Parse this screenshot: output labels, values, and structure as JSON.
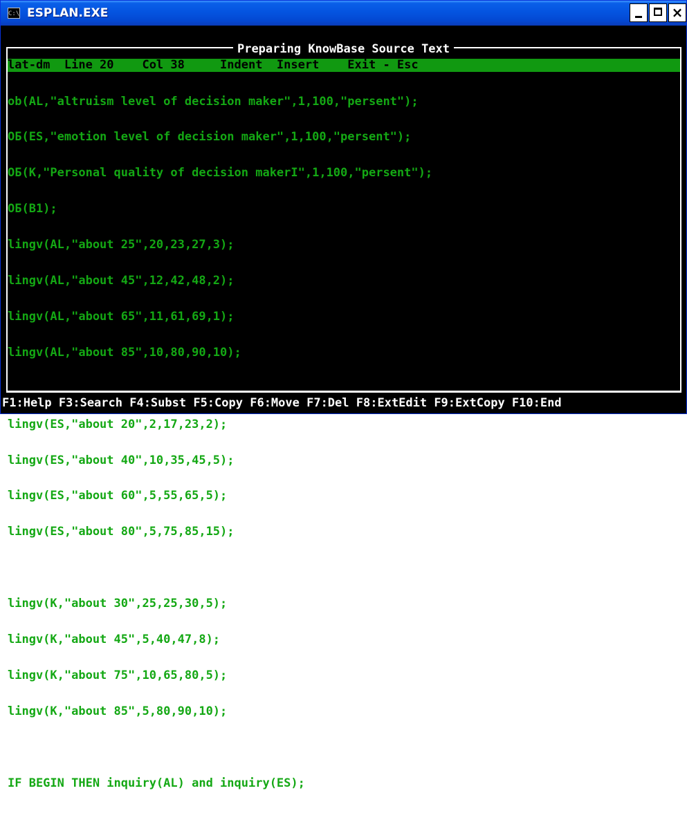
{
  "window": {
    "title": "ESPLAN.EXE",
    "icon_label": "C:\\",
    "close_label": "×"
  },
  "frame": {
    "title": "Preparing KnowBase Source Text"
  },
  "status_bar": {
    "text": "lat-dm  Line 20    Col 38     Indent  Insert    Exit - Esc"
  },
  "editor": {
    "lines": [
      "ob(AL,\"altruism level of decision maker\",1,100,\"persent\");",
      "OБ(ES,\"emotion level of decision maker\",1,100,\"persent\");",
      "OБ(K,\"Personal quality of decision makerI\",1,100,\"persent\");",
      "OБ(B1);",
      "lingv(AL,\"about 25\",20,23,27,3);",
      "lingv(AL,\"about 45\",12,42,48,2);",
      "lingv(AL,\"about 65\",11,61,69,1);",
      "lingv(AL,\"about 85\",10,80,90,10);",
      "",
      "lingv(ES,\"about 20\",2,17,23,2);",
      "lingv(ES,\"about 40\",10,35,45,5);",
      "lingv(ES,\"about 60\",5,55,65,5);",
      "lingv(ES,\"about 80\",5,75,85,15);",
      "",
      "lingv(K,\"about 30\",25,25,30,5);",
      "lingv(K,\"about 45\",5,40,47,8);",
      "lingv(K,\"about 75\",10,65,80,5);",
      "lingv(K,\"about 85\",5,80,90,10);",
      "",
      "IF BEGIN THEN inquiry(AL) and inquiry(ES);"
    ]
  },
  "function_keys": {
    "text": "F1:Help F3:Search F4:Subst F5:Copy F6:Move F7:Del F8:ExtEdit F9:ExtCopy F10:End"
  },
  "colors": {
    "text_green": "#14a814",
    "status_green": "#119911",
    "titlebar_blue": "#0454e0"
  },
  "icons": {
    "app": "console-icon",
    "minimize": "minimize-icon",
    "maximize": "maximize-icon",
    "close": "close-icon"
  }
}
